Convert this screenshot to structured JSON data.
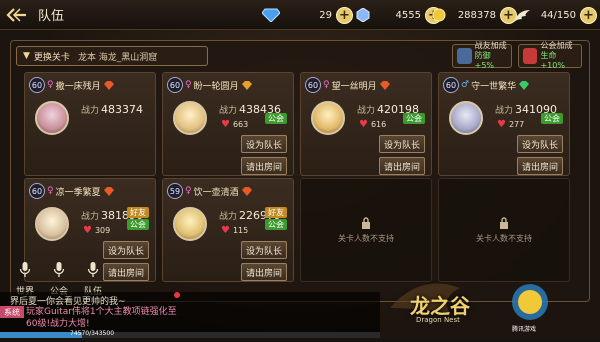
{
  "header": {
    "title": "队伍",
    "back_icon": "back-arrow-icon"
  },
  "resources": [
    {
      "icon": "diamond-icon",
      "value": "29",
      "color": "#4aa0f0"
    },
    {
      "icon": "crystal-icon",
      "value": "4555",
      "color": "#8ab8f8"
    },
    {
      "icon": "gold-coin-icon",
      "value": "288378",
      "color": "#f0c838"
    },
    {
      "icon": "wing-stamina-icon",
      "value": "44/150",
      "color": "#f0e8d0"
    }
  ],
  "stage": {
    "button_label": "更换关卡",
    "name": "龙本 海龙_黑山洞窟"
  },
  "buffs": {
    "friend": {
      "line1": "战友加成",
      "line2": "防御+5%"
    },
    "guild": {
      "line1": "公会加成",
      "line2": "生命+10%"
    }
  },
  "slots": [
    {
      "level": "60",
      "name": "撒一床残月",
      "power_label": "战力",
      "power": "483374",
      "likes": "",
      "tags": [],
      "buttons": []
    },
    {
      "level": "60",
      "name": "盼一轮圆月",
      "power_label": "战力",
      "power": "438436",
      "likes": "663",
      "tags": [
        "公会"
      ],
      "buttons": [
        "设为队长",
        "请出房间"
      ]
    },
    {
      "level": "60",
      "name": "望一丝明月",
      "power_label": "战力",
      "power": "420198",
      "likes": "616",
      "tags": [
        "公会"
      ],
      "buttons": [
        "设为队长",
        "请出房间"
      ]
    },
    {
      "level": "60",
      "name": "守一世繁华",
      "power_label": "战力",
      "power": "341090",
      "likes": "277",
      "tags": [
        "公会"
      ],
      "buttons": [
        "设为队长",
        "请出房间"
      ]
    },
    {
      "level": "60",
      "name": "凉一季繁夏",
      "power_label": "战力",
      "power": "381896",
      "likes": "309",
      "tags": [
        "好友",
        "公会"
      ],
      "buttons": [
        "设为队长",
        "请出房间"
      ]
    },
    {
      "level": "59",
      "name": "饮一壶清酒",
      "power_label": "战力",
      "power": "226979",
      "likes": "115",
      "tags": [
        "好友",
        "公会"
      ],
      "buttons": [
        "设为队长",
        "请出房间"
      ]
    }
  ],
  "empty_slot_text": "关卡人数不支持",
  "chat": {
    "tabs": [
      "世界",
      "公会",
      "队伍"
    ],
    "line1": "界后夏一你会看见更帅的我~",
    "system_badge": "系统",
    "line2": "玩家Guitar伟将1个大主教项链强化至60级!战力大增!",
    "exp": "74570/343500",
    "exp_ratio": 0.217
  },
  "logo": {
    "text": "龙之谷",
    "sub": "Dragon Nest",
    "brand": "腾讯游戏"
  }
}
